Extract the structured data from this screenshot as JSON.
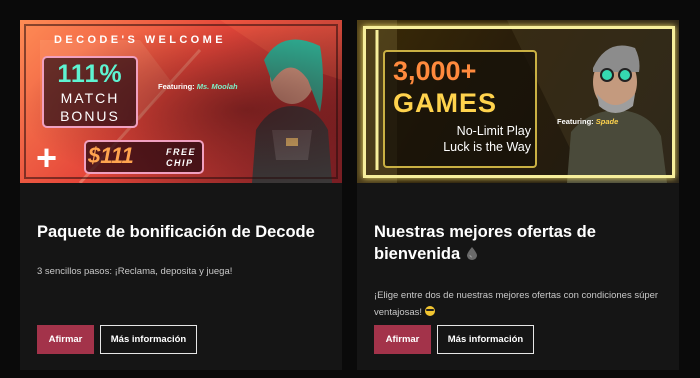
{
  "cards": [
    {
      "banner": {
        "headline": "DECODE'S WELCOME",
        "big": "111%",
        "line1": "MATCH",
        "line2": "BONUS",
        "featuring_label": "Featuring:",
        "featuring_name": "Ms. Moolah",
        "plus": "+",
        "chip_amount": "$111",
        "chip_line1": "FREE",
        "chip_line2": "CHIP"
      },
      "title": "Paquete de bonificación de Decode",
      "description": "3 sencillos pasos: ¡Reclama, deposita y juega!",
      "primary_label": "Afirmar",
      "secondary_label": "Más información"
    },
    {
      "banner": {
        "big": "3,000+",
        "line1": "GAMES",
        "line2": "No-Limit Play",
        "line3": "Luck is the Way",
        "featuring_label": "Featuring:",
        "featuring_name": "Spade"
      },
      "title": "Nuestras mejores ofertas de bienvenida",
      "title_icon": "ink-drop-icon",
      "description": "¡Elige entre dos de nuestras mejores ofertas con condiciones súper ventajosas!",
      "description_icon": "smiling-face-emoji",
      "primary_label": "Afirmar",
      "secondary_label": "Más información"
    }
  ],
  "colors": {
    "page_background": "#0a0a0a",
    "card_background": "#151515",
    "primary_button": "#a3334a"
  }
}
